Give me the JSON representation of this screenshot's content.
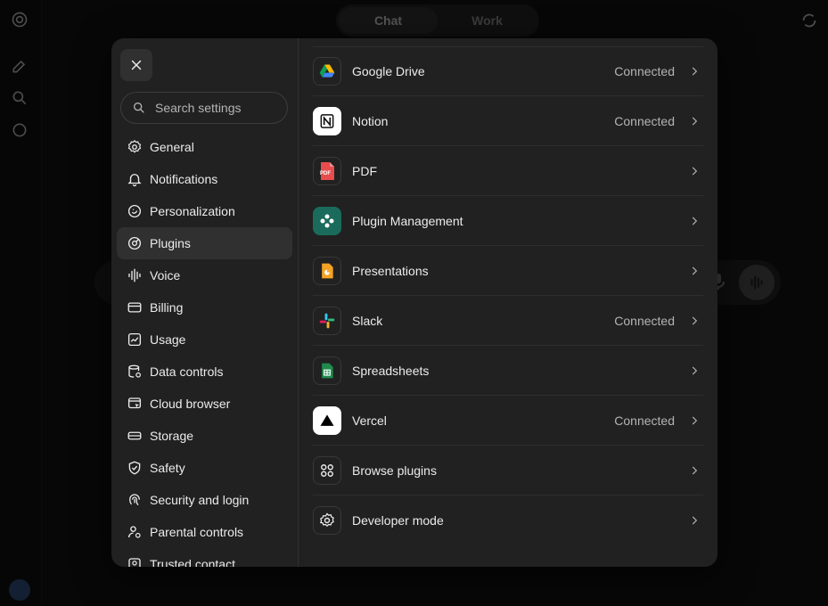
{
  "background": {
    "mode_tabs": [
      {
        "label": "Chat",
        "active": true
      },
      {
        "label": "Work",
        "active": false
      }
    ]
  },
  "settings": {
    "search": {
      "placeholder": "Search settings"
    },
    "nav": [
      {
        "label": "General",
        "icon": "gear-icon"
      },
      {
        "label": "Notifications",
        "icon": "bell-icon"
      },
      {
        "label": "Personalization",
        "icon": "personalization-icon"
      },
      {
        "label": "Plugins",
        "icon": "plugin-icon",
        "active": true
      },
      {
        "label": "Voice",
        "icon": "waveform-icon"
      },
      {
        "label": "Billing",
        "icon": "credit-card-icon"
      },
      {
        "label": "Usage",
        "icon": "usage-chart-icon"
      },
      {
        "label": "Data controls",
        "icon": "database-icon"
      },
      {
        "label": "Cloud browser",
        "icon": "cloud-browser-icon"
      },
      {
        "label": "Storage",
        "icon": "storage-icon"
      },
      {
        "label": "Safety",
        "icon": "shield-check-icon"
      },
      {
        "label": "Security and login",
        "icon": "fingerprint-icon"
      },
      {
        "label": "Parental controls",
        "icon": "parental-icon"
      },
      {
        "label": "Trusted contact",
        "icon": "trusted-contact-icon"
      }
    ],
    "plugins": [
      {
        "name": "Google Drive",
        "status": "Connected",
        "icon": "google-drive-icon"
      },
      {
        "name": "Notion",
        "status": "Connected",
        "icon": "notion-icon"
      },
      {
        "name": "PDF",
        "status": "",
        "icon": "pdf-icon",
        "badge": "PDF"
      },
      {
        "name": "Plugin Management",
        "status": "",
        "icon": "plugin-management-icon"
      },
      {
        "name": "Presentations",
        "status": "",
        "icon": "presentations-icon"
      },
      {
        "name": "Slack",
        "status": "Connected",
        "icon": "slack-icon"
      },
      {
        "name": "Spreadsheets",
        "status": "",
        "icon": "spreadsheets-icon"
      },
      {
        "name": "Vercel",
        "status": "Connected",
        "icon": "vercel-icon"
      },
      {
        "name": "Browse plugins",
        "status": "",
        "icon": "grid-icon"
      },
      {
        "name": "Developer mode",
        "status": "",
        "icon": "gear-icon"
      }
    ]
  },
  "colors": {
    "modal_bg": "#212121",
    "active_nav_bg": "#303030",
    "text_primary": "#ececec",
    "text_secondary": "#b4b4b4"
  }
}
